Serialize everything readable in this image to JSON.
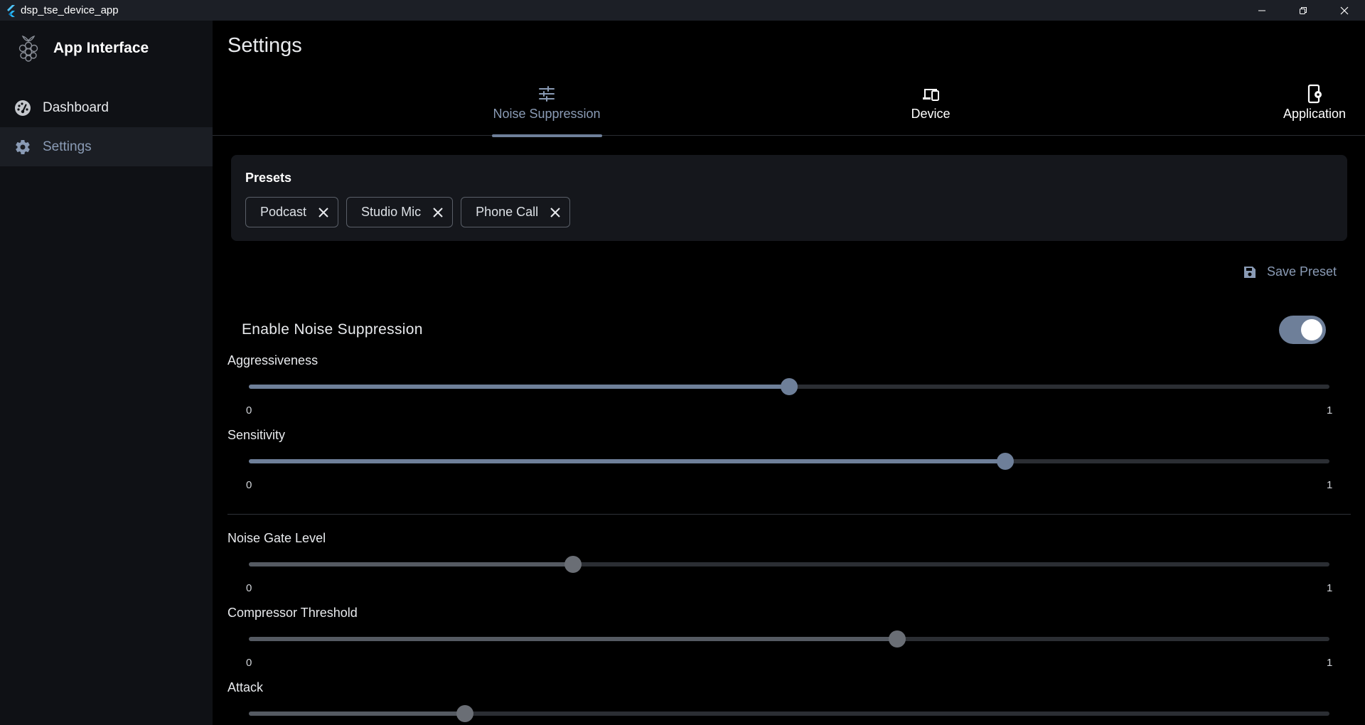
{
  "window": {
    "title": "dsp_tse_device_app"
  },
  "sidebar": {
    "brand": "App Interface",
    "items": [
      {
        "label": "Dashboard",
        "icon": "dashboard-icon"
      },
      {
        "label": "Settings",
        "icon": "gear-icon"
      }
    ]
  },
  "page": {
    "title": "Settings"
  },
  "tabs": [
    {
      "label": "Noise Suppression",
      "icon": "tune-icon",
      "selected": true
    },
    {
      "label": "Device",
      "icon": "devices-icon",
      "selected": false
    },
    {
      "label": "Application",
      "icon": "app-settings-icon",
      "selected": false
    }
  ],
  "presets": {
    "title": "Presets",
    "chips": [
      "Podcast",
      "Studio Mic",
      "Phone Call"
    ]
  },
  "save_preset": {
    "label": "Save Preset"
  },
  "enable": {
    "label": "Enable Noise Suppression",
    "on": true
  },
  "sliders": [
    {
      "label": "Aggressiveness",
      "value": 0.5,
      "min": "0",
      "max": "1"
    },
    {
      "label": "Sensitivity",
      "value": 0.7,
      "min": "0",
      "max": "1"
    },
    {
      "label": "Noise Gate Level",
      "value": 0.3,
      "min": "0",
      "max": "1"
    },
    {
      "label": "Compressor Threshold",
      "value": 0.6,
      "min": "0",
      "max": "1"
    },
    {
      "label": "Attack",
      "value": 0.2
    }
  ],
  "colors": {
    "accent": "#6e7f99",
    "background": "#000000",
    "sidebar": "#0f1115",
    "card": "#15171c",
    "titlebar": "#1c1f26"
  }
}
